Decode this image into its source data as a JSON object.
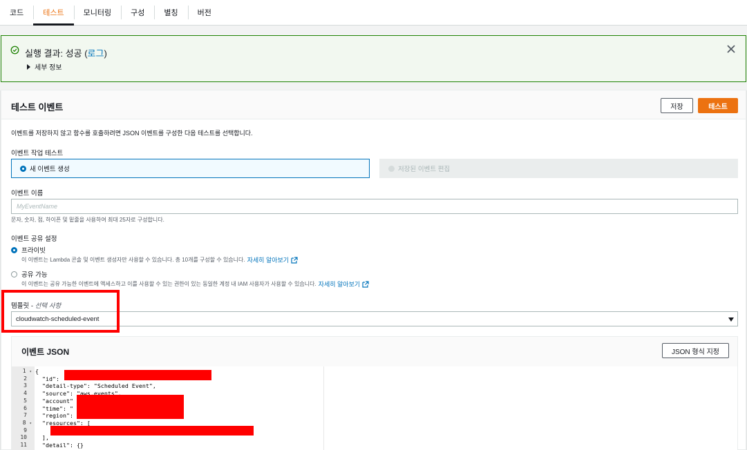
{
  "tabs": [
    {
      "label": "코드",
      "active": false
    },
    {
      "label": "테스트",
      "active": true
    },
    {
      "label": "모니터링",
      "active": false
    },
    {
      "label": "구성",
      "active": false
    },
    {
      "label": "별칭",
      "active": false
    },
    {
      "label": "버전",
      "active": false
    }
  ],
  "flash": {
    "title_prefix": "실행 결과: 성공 (",
    "log_link": "로그",
    "title_suffix": ")",
    "details": "세부 정보",
    "icon": "check-circle-icon",
    "color": "#1d8102"
  },
  "panel": {
    "title": "테스트 이벤트",
    "save_label": "저장",
    "test_label": "테스트",
    "description": "이벤트를 저장하지 않고 함수를 호출하려면 JSON 이벤트를 구성한 다음 테스트를 선택합니다.",
    "action_label": "이벤트 작업 테스트",
    "action_new": "새 이벤트 생성",
    "action_saved": "저장된 이벤트 편집",
    "name_label": "이벤트 이름",
    "name_placeholder": "MyEventName",
    "name_hint": "문자, 숫자, 점, 하이픈 및 밑줄을 사용하여 최대 25자로 구성합니다.",
    "sharing_label": "이벤트 공유 설정",
    "private_label": "프라이빗",
    "private_desc": "이 이벤트는 Lambda 콘솔 및 이벤트 생성자만 사용할 수 있습니다. 총 10개를 구성할 수 있습니다.",
    "shareable_label": "공유 가능",
    "shareable_desc": "이 이벤트는 공유 가능한 이벤트에 액세스하고 이를 사용할 수 있는 권한이 있는 동일한 계정 내 IAM 사용자가 사용할 수 있습니다.",
    "learn_more": "자세히 알아보기",
    "template_label": "템플릿 - ",
    "template_optional": "선택 사항",
    "template_value": "cloudwatch-scheduled-event",
    "accent": "#ec7211"
  },
  "json": {
    "title": "이벤트 JSON",
    "format_label": "JSON 형식 지정",
    "line_numbers": [
      "1",
      "2",
      "3",
      "4",
      "5",
      "6",
      "7",
      "8",
      "9",
      "10",
      "11"
    ],
    "lines": [
      "{",
      "  \"id\": ",
      "  \"detail-type\": \"Scheduled Event\",",
      "  \"source\": \"aws.events\",",
      "  \"account\"",
      "  \"time\": \"",
      "  \"region\":",
      "  \"resources\": [",
      "    ",
      "  ],",
      "  \"detail\": {}"
    ]
  }
}
